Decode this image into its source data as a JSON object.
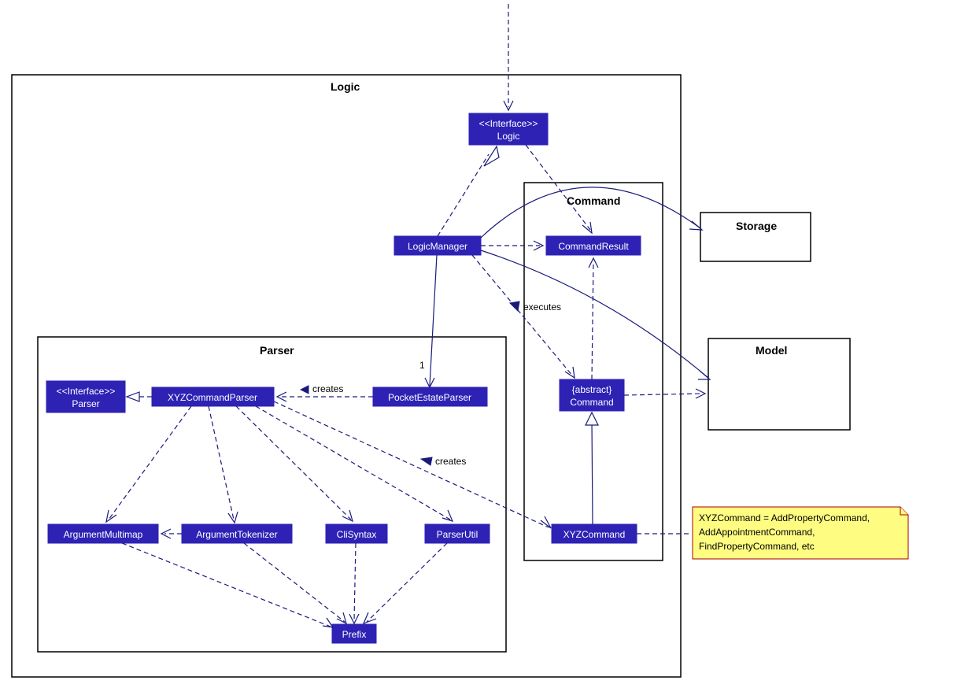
{
  "packages": {
    "logic": "Logic",
    "parser": "Parser",
    "command": "Command"
  },
  "external": {
    "storage": "Storage",
    "model": "Model"
  },
  "classes": {
    "logic_iface_stereo": "<<Interface>>",
    "logic_iface_name": "Logic",
    "logic_manager": "LogicManager",
    "command_result": "CommandResult",
    "abstract_command_stereo": "{abstract}",
    "abstract_command_name": "Command",
    "xyz_command": "XYZCommand",
    "parser_iface_stereo": "<<Interface>>",
    "parser_iface_name": "Parser",
    "xyz_command_parser": "XYZCommandParser",
    "pocket_estate_parser": "PocketEstateParser",
    "argument_multimap": "ArgumentMultimap",
    "argument_tokenizer": "ArgumentTokenizer",
    "cli_syntax": "CliSyntax",
    "parser_util": "ParserUtil",
    "prefix": "Prefix"
  },
  "labels": {
    "executes": "executes",
    "creates1": "creates",
    "creates2": "creates"
  },
  "note": {
    "line1": "XYZCommand = AddPropertyCommand,",
    "line2": "AddAppointmentCommand,",
    "line3": "FindPropertyCommand, etc"
  }
}
